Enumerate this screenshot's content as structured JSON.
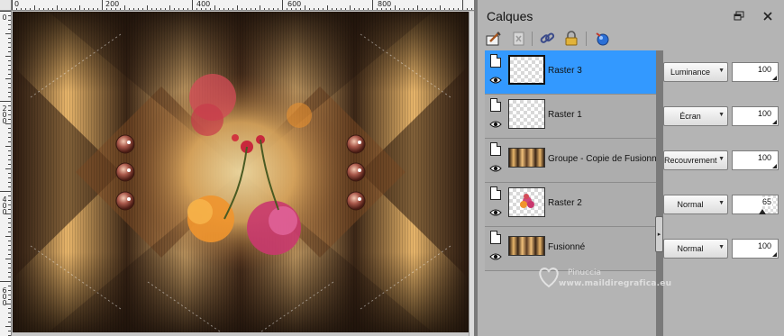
{
  "rulers": {
    "top_labels": [
      "0",
      "200",
      "400",
      "600",
      "800"
    ],
    "left_labels": [
      "0",
      "2 0 0",
      "4 0 0",
      "6 0 0"
    ]
  },
  "panel": {
    "title": "Calques",
    "float_icon": "float-window-icon",
    "close_icon": "close-icon"
  },
  "toolbar": {
    "tools": [
      "layer-properties-icon",
      "delete-layer-icon",
      "link-icon",
      "lock-icon",
      "mask-icon"
    ]
  },
  "layers": [
    {
      "name": "Raster 3",
      "selected": true,
      "blend": "Luminance",
      "opacity": "100",
      "opacity_level": 1.0,
      "thumb": "transparent"
    },
    {
      "name": "Raster 1",
      "selected": false,
      "blend": "Écran",
      "opacity": "100",
      "opacity_level": 1.0,
      "thumb": "transparent"
    },
    {
      "name": "Groupe - Copie de Fusionné",
      "selected": false,
      "blend": "Recouvrement",
      "opacity": "100",
      "opacity_level": 1.0,
      "thumb": "artwork"
    },
    {
      "name": "Raster 2",
      "selected": false,
      "blend": "Normal",
      "opacity": "65",
      "opacity_level": 0.65,
      "thumb": "flowers"
    },
    {
      "name": "Fusionné",
      "selected": false,
      "blend": "Normal",
      "opacity": "100",
      "opacity_level": 1.0,
      "thumb": "artwork"
    }
  ],
  "watermark": {
    "line1": "Pinuccia",
    "line2": "www.maildiregrafica.eu"
  },
  "colors": {
    "selection": "#3399ff",
    "panel_bg": "#b4b4b4",
    "art_dark": "#3a2818",
    "art_gold": "#e8b56a"
  }
}
